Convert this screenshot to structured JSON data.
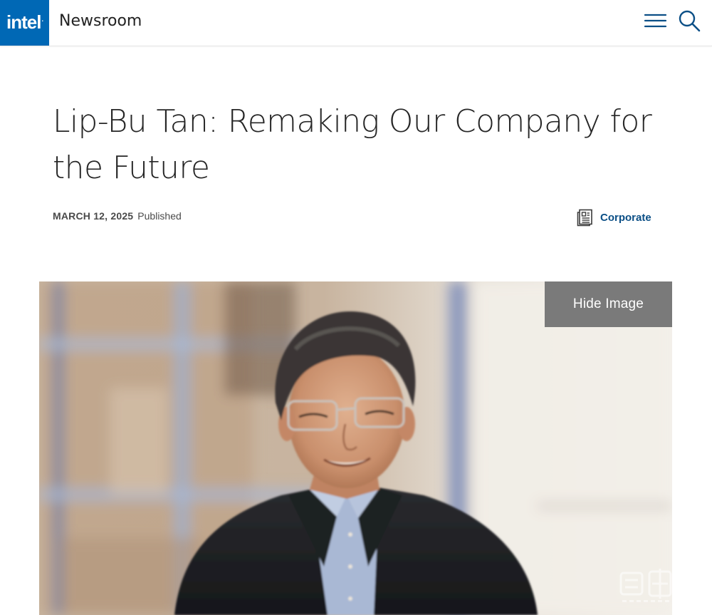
{
  "header": {
    "logo_text": "intel",
    "site_name": "Newsroom",
    "menu_icon": "hamburger-menu-icon",
    "search_icon": "search-icon",
    "brand_color": "#0068b5"
  },
  "article": {
    "title": "Lip-Bu Tan: Remaking Our Company for the Future",
    "date": "MARCH 12, 2025",
    "status": "Published",
    "category": {
      "label": "Corporate",
      "icon": "newspaper-icon",
      "color": "#0b4f86"
    }
  },
  "hero": {
    "hide_button_label": "Hide Image",
    "description": "portrait-photo",
    "watermark_logo": "zhidx-watermark-logo"
  }
}
